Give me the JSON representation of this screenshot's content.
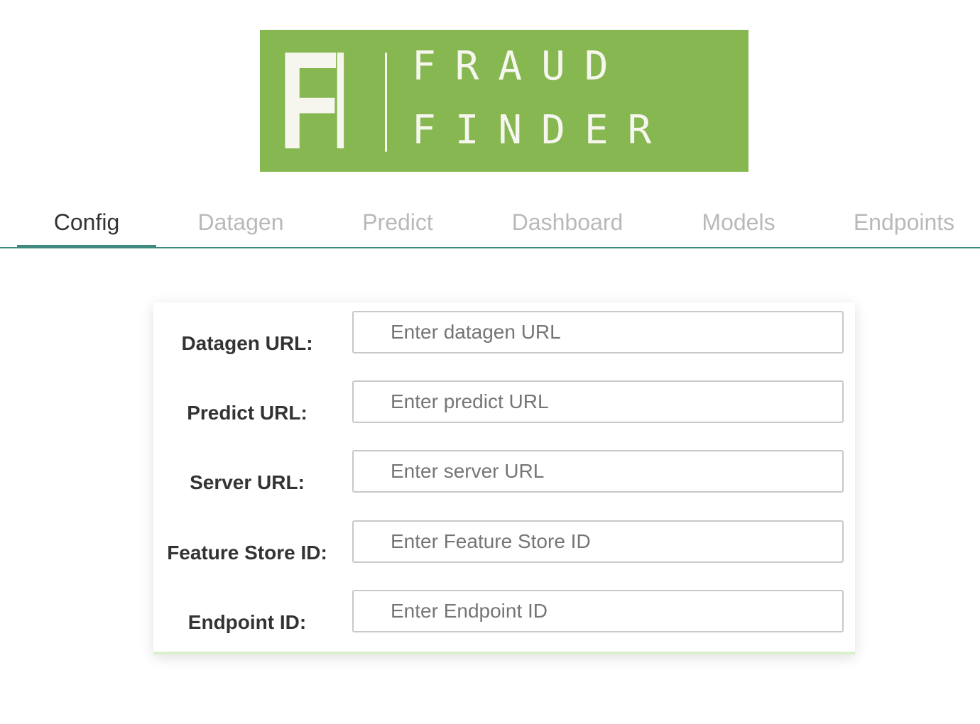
{
  "logo": {
    "mark": "FF",
    "line1": "FRAUD",
    "line2": "FINDER",
    "background_color": "#86b751"
  },
  "tabs": [
    {
      "label": "Config",
      "active": true
    },
    {
      "label": "Datagen",
      "active": false
    },
    {
      "label": "Predict",
      "active": false
    },
    {
      "label": "Dashboard",
      "active": false
    },
    {
      "label": "Models",
      "active": false
    },
    {
      "label": "Endpoints",
      "active": false
    }
  ],
  "accent_color": "#3f8a80",
  "form": {
    "fields": [
      {
        "label": "Datagen URL:",
        "placeholder": "Enter datagen URL",
        "value": ""
      },
      {
        "label": "Predict URL:",
        "placeholder": "Enter predict URL",
        "value": ""
      },
      {
        "label": "Server URL:",
        "placeholder": "Enter server URL",
        "value": ""
      },
      {
        "label": "Feature Store ID:",
        "placeholder": "Enter Feature Store ID",
        "value": ""
      },
      {
        "label": "Endpoint ID:",
        "placeholder": "Enter Endpoint ID",
        "value": ""
      }
    ]
  }
}
